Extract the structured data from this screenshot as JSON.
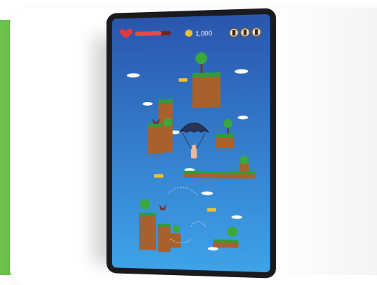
{
  "game": {
    "coins": "1,000",
    "health_fraction": 0.75,
    "colors": {
      "sky_top": "#2f5fb3",
      "sky_bottom": "#3fa0e6",
      "grass": "#2f9e3a",
      "dirt": "#a8602d",
      "coin": "#f2c12e",
      "heart": "#e23a3a"
    },
    "icons": [
      "heart-icon",
      "coin-icon",
      "settings-icon",
      "pause-icon",
      "menu-icon"
    ]
  }
}
